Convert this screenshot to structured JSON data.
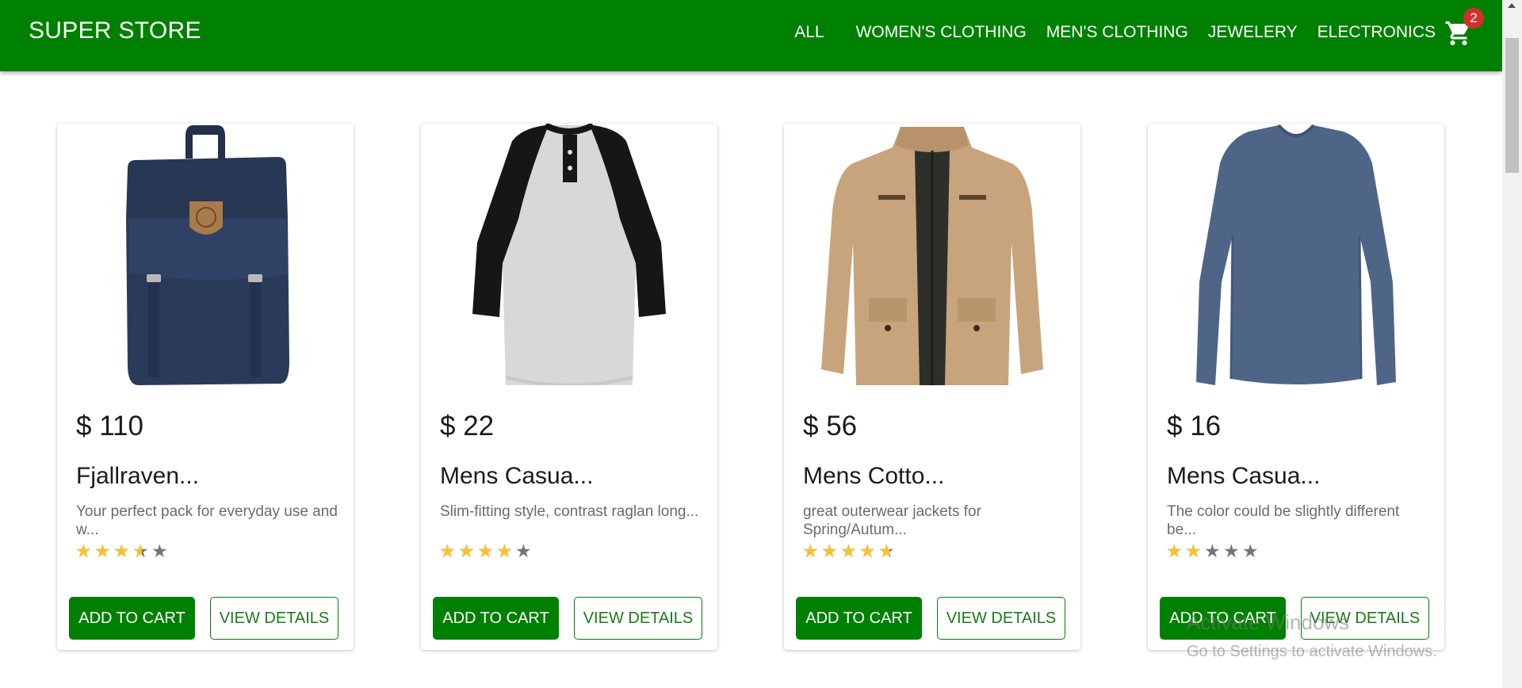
{
  "header": {
    "brand": "SUPER STORE",
    "nav": [
      "ALL",
      "WOMEN'S CLOTHING",
      "MEN'S CLOTHING",
      "JEWELERY",
      "ELECTRONICS"
    ],
    "cart_icon": "shopping-cart-icon",
    "cart_count": "2",
    "color": "#008000"
  },
  "products": [
    {
      "price": "$ 110",
      "title": "Fjallraven...",
      "description": "Your perfect pack for everyday use and w...",
      "rating": 3.5,
      "image": "navy-backpack",
      "add_label": "ADD TO CART",
      "view_label": "VIEW DETAILS"
    },
    {
      "price": "$ 22",
      "title": "Mens Casua...",
      "description": "Slim-fitting style, contrast raglan long...",
      "rating": 4,
      "image": "raglan-henley-shirt",
      "add_label": "ADD TO CART",
      "view_label": "VIEW DETAILS"
    },
    {
      "price": "$ 56",
      "title": "Mens Cotto...",
      "description": "great outerwear jackets for Spring/Autum...",
      "rating": 4.6,
      "image": "khaki-cotton-jacket",
      "add_label": "ADD TO CART",
      "view_label": "VIEW DETAILS"
    },
    {
      "price": "$ 16",
      "title": "Mens Casua...",
      "description": "The color could be slightly different be...",
      "rating": 2,
      "image": "blue-long-sleeve-shirt",
      "add_label": "ADD TO CART",
      "view_label": "VIEW DETAILS"
    }
  ],
  "watermark": {
    "line1": "Activate Windows",
    "line2": "Go to Settings to activate Windows."
  }
}
